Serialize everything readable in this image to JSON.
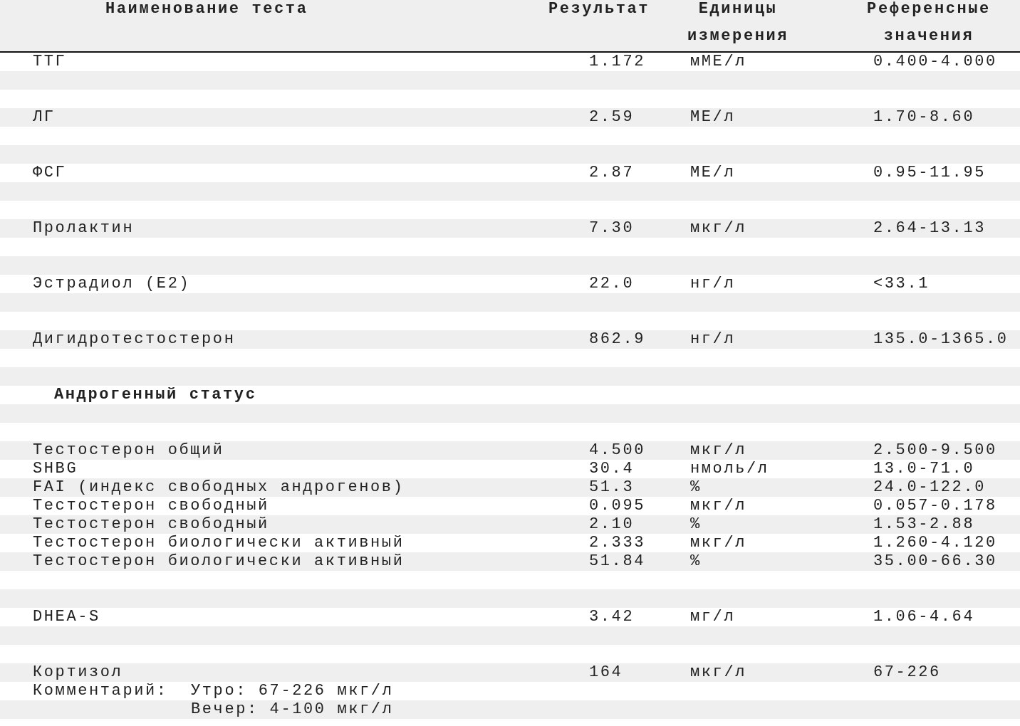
{
  "columns": [
    [
      "Наименование теста"
    ],
    [
      "Результат"
    ],
    [
      "Единицы",
      "измерения"
    ],
    [
      "Референсные",
      "значения"
    ]
  ],
  "blocks": [
    {
      "kind": "tests",
      "rows": [
        {
          "name": "ТТГ",
          "result": "1.172",
          "unit": "мМЕ/л",
          "reference": "0.400-4.000"
        }
      ]
    },
    {
      "kind": "tests",
      "rows": [
        {
          "name": "ЛГ",
          "result": "2.59",
          "unit": "МЕ/л",
          "reference": "1.70-8.60"
        }
      ]
    },
    {
      "kind": "tests",
      "rows": [
        {
          "name": "ФСГ",
          "result": "2.87",
          "unit": "МЕ/л",
          "reference": "0.95-11.95"
        }
      ]
    },
    {
      "kind": "tests",
      "rows": [
        {
          "name": "Пролактин",
          "result": "7.30",
          "unit": "мкг/л",
          "reference": "2.64-13.13"
        }
      ]
    },
    {
      "kind": "tests",
      "rows": [
        {
          "name": "Эстрадиол (E2)",
          "result": "22.0",
          "unit": "нг/л",
          "reference": "<33.1"
        }
      ]
    },
    {
      "kind": "tests",
      "rows": [
        {
          "name": "Дигидротестостерон",
          "result": "862.9",
          "unit": "нг/л",
          "reference": "135.0-1365.0"
        }
      ]
    },
    {
      "kind": "section",
      "title": "Андрогенный статус"
    },
    {
      "kind": "tests",
      "rows": [
        {
          "name": "Тестостерон общий",
          "result": "4.500",
          "unit": "мкг/л",
          "reference": "2.500-9.500"
        },
        {
          "name": "SHBG",
          "result": "30.4",
          "unit": "нмоль/л",
          "reference": "13.0-71.0"
        },
        {
          "name": "FAI (индекс свободных андрогенов)",
          "result": "51.3",
          "unit": "%",
          "reference": "24.0-122.0"
        },
        {
          "name": "Тестостерон свободный",
          "result": "0.095",
          "unit": "мкг/л",
          "reference": "0.057-0.178"
        },
        {
          "name": "Тестостерон свободный",
          "result": "2.10",
          "unit": "%",
          "reference": "1.53-2.88"
        },
        {
          "name": "Тестостерон биологически активный",
          "result": "2.333",
          "unit": "мкг/л",
          "reference": "1.260-4.120"
        },
        {
          "name": "Тестостерон биологически активный",
          "result": "51.84",
          "unit": "%",
          "reference": "35.00-66.30"
        }
      ]
    },
    {
      "kind": "tests",
      "rows": [
        {
          "name": "DHEA-S",
          "result": "3.42",
          "unit": "мг/л",
          "reference": "1.06-4.64"
        }
      ]
    },
    {
      "kind": "tests",
      "rows": [
        {
          "name": "Кортизол",
          "result": "164",
          "unit": "мкг/л",
          "reference": "67-226"
        }
      ],
      "comment": {
        "label": "Комментарий:",
        "lines": [
          "Утро: 67-226 мкг/л",
          "Вечер: 4-100 мкг/л"
        ]
      }
    }
  ]
}
